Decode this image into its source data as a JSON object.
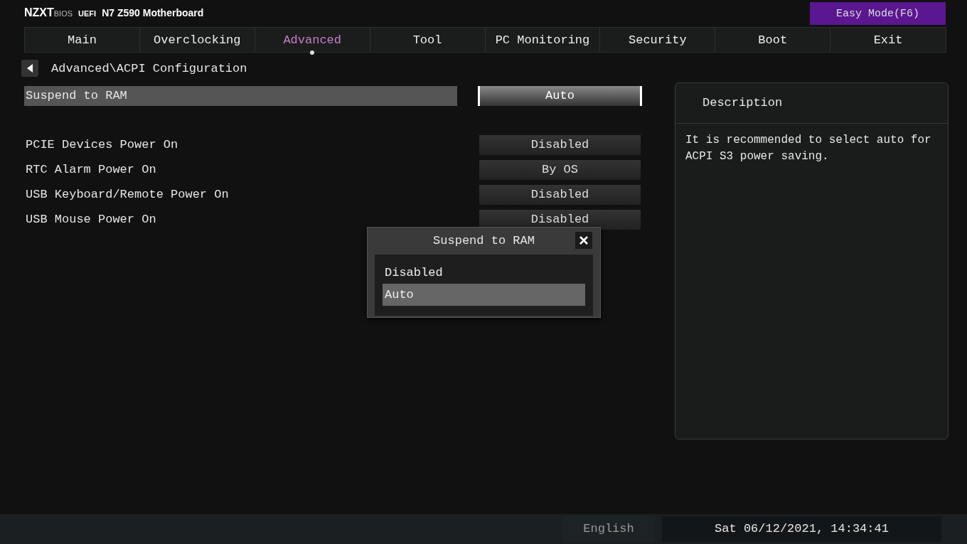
{
  "header": {
    "brand": "NZXT",
    "brand_suffix": "BIOS",
    "uefi": "UEFI",
    "model": "N7 Z590 Motherboard",
    "mode_button": "Easy Mode(F6)"
  },
  "tabs": [
    {
      "label": "Main",
      "selected": false
    },
    {
      "label": "Overclocking",
      "selected": false
    },
    {
      "label": "Advanced",
      "selected": true
    },
    {
      "label": "Tool",
      "selected": false
    },
    {
      "label": "PC Monitoring",
      "selected": false
    },
    {
      "label": "Security",
      "selected": false
    },
    {
      "label": "Boot",
      "selected": false
    },
    {
      "label": "Exit",
      "selected": false
    }
  ],
  "breadcrumb": "Advanced\\ACPI Configuration",
  "setting_groups": [
    {
      "items": [
        {
          "label": "Suspend to RAM",
          "value": "Auto",
          "selected": true
        }
      ]
    },
    {
      "items": [
        {
          "label": "PCIE Devices Power On",
          "value": "Disabled",
          "selected": false
        },
        {
          "label": "RTC Alarm Power On",
          "value": "By OS",
          "selected": false
        },
        {
          "label": "USB Keyboard/Remote Power On",
          "value": "Disabled",
          "selected": false
        },
        {
          "label": "USB Mouse Power On",
          "value": "Disabled",
          "selected": false
        }
      ]
    }
  ],
  "description": {
    "title": "Description",
    "text": "It is recommended to select auto for ACPI S3 power saving."
  },
  "dialog": {
    "title": "Suspend to RAM",
    "options": [
      {
        "label": "Disabled",
        "selected": false
      },
      {
        "label": "Auto",
        "selected": true
      }
    ]
  },
  "status_bar": {
    "language": "English",
    "datetime": "Sat 06/12/2021, 14:34:41"
  }
}
